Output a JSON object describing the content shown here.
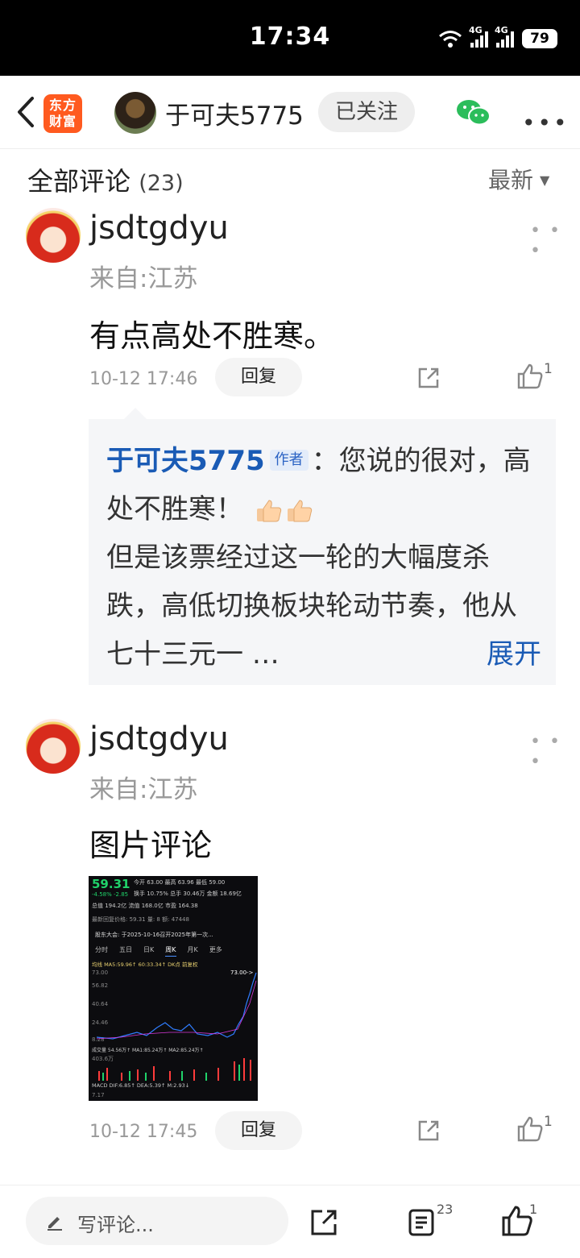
{
  "status_bar": {
    "time": "17:34",
    "network1": "4G",
    "network2": "4G",
    "battery": "79"
  },
  "header": {
    "app_logo": "东方\n财富",
    "author_name": "于可夫5775",
    "follow_label": "已关注"
  },
  "section": {
    "title": "全部评论",
    "count": "(23)",
    "sort_label": "最新"
  },
  "comments": [
    {
      "user": "jsdtgdyu",
      "location": "来自:江苏",
      "text": "有点高处不胜寒。",
      "time": "10-12 17:46",
      "reply_label": "回复",
      "likes": "1",
      "author_reply": {
        "author": "于可夫5775",
        "tag": "作者",
        "text1": "：您说的很对，高处不胜寒！",
        "text2": "但是该票经过这一轮的大幅度杀跌，高低切换板块轮动节奏，他从七十三元一 …",
        "expand_label": "展开"
      }
    },
    {
      "user": "jsdtgdyu",
      "location": "来自:江苏",
      "text": "图片评论",
      "time": "10-12 17:45",
      "reply_label": "回复",
      "likes": "1"
    }
  ],
  "chart_image": {
    "price": "59.31",
    "change": "-4.58%  -2.85",
    "row1": "今开 63.00  最高 63.96  最低 59.00",
    "row2": "换手 10.75%  总手 30.46万  金额 18.69亿",
    "row3": "总值 194.2亿  流值 168.0亿  市盈 164.38",
    "row4": "最新回复价格: 59.31  量: 8  额: 47448",
    "row5": "股东大会: 于2025-10-16召开2025年第一次...",
    "tabs": [
      "分时",
      "五日",
      "日K",
      "周K",
      "月K",
      "更多"
    ],
    "row6": "均线 MA5:59.96↑ 60:33.34↑  DK点  前复权",
    "y_labels": [
      "73.00",
      "56.82",
      "40.64",
      "24.46",
      "8.28"
    ],
    "top_right": "73.00->",
    "row7": "成交量 54.56万↑ MA1:85.24万↑ MA2:85.24万↑",
    "vol_label": "403.6万",
    "row8": "MACD  DIF:6.85↑ DEA:5.39↑ M:2.93↓",
    "macd_label": "7.17"
  },
  "bottom_bar": {
    "placeholder": "写评论...",
    "comment_count": "23",
    "like_count": "1"
  },
  "colors": {
    "link_blue": "#1a5bb5",
    "brand_orange": "#ff5a1f",
    "wechat_green": "#2bbd5b",
    "chart_green": "#20d26a",
    "chart_red": "#ff3b3b",
    "chart_blue": "#2f7dff"
  }
}
